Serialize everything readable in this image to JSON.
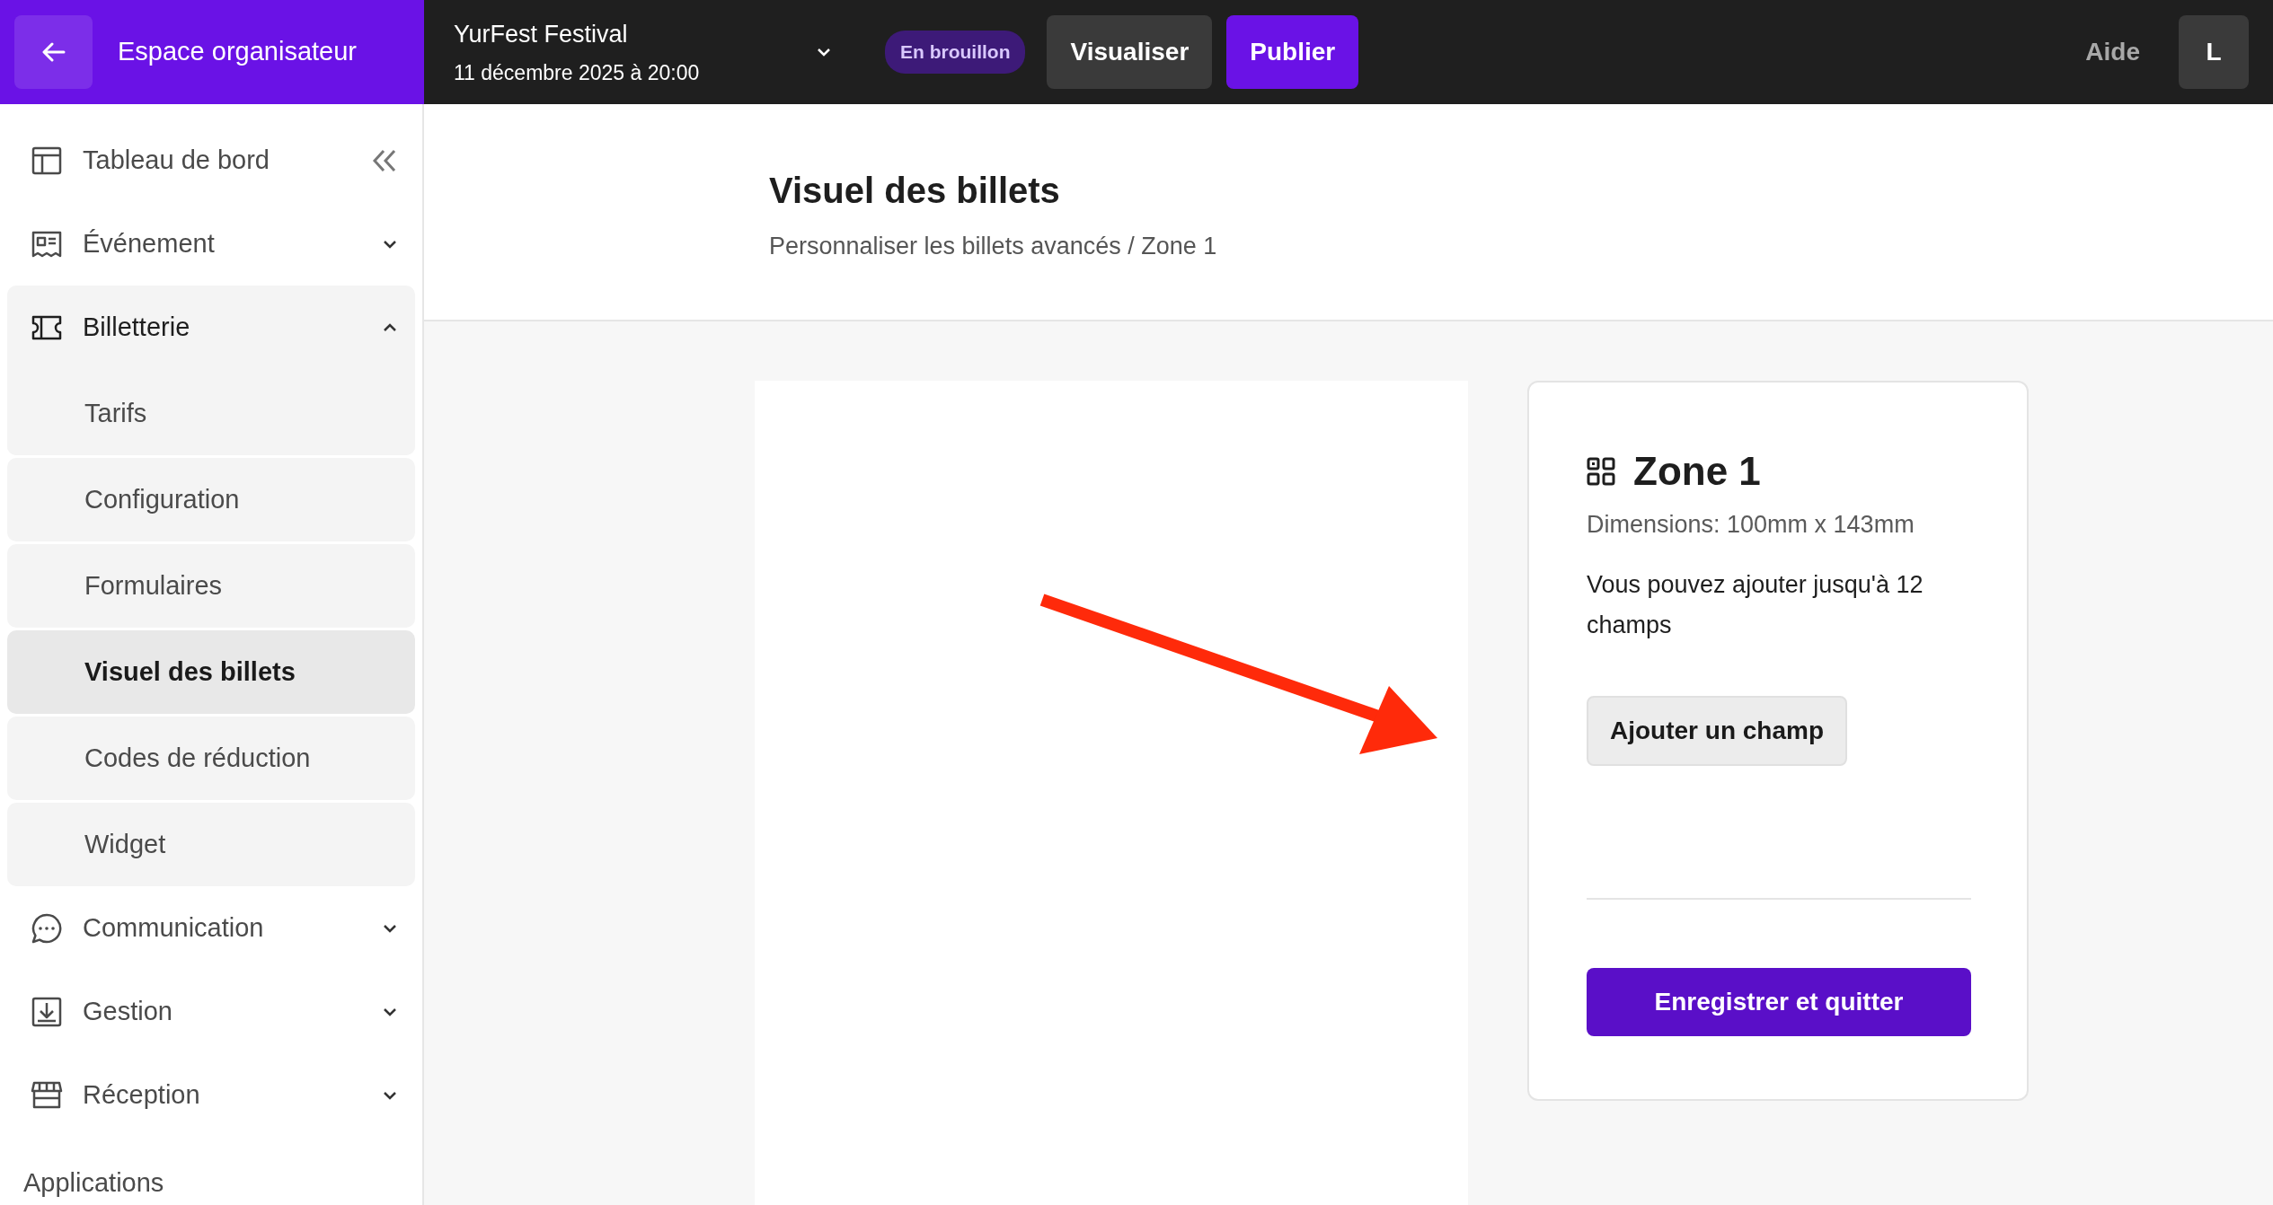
{
  "top_bar": {
    "brand": "Espace organisateur",
    "event": {
      "name": "YurFest Festival",
      "date": "11 décembre 2025 à 20:00"
    },
    "status_badge": "En brouillon",
    "buttons": [
      {
        "label": "Visualiser",
        "kind": "secondary"
      },
      {
        "label": "Publier",
        "kind": "primary"
      }
    ],
    "help": "Aide",
    "avatar": "L"
  },
  "sidebar": {
    "items": [
      {
        "label": "Tableau de bord"
      },
      {
        "label": "Événement",
        "expanded": false
      },
      {
        "label": "Billetterie",
        "expanded": true,
        "children": [
          {
            "label": "Tarifs",
            "selected": false
          },
          {
            "label": "Configuration",
            "selected": false
          },
          {
            "label": "Formulaires",
            "selected": false
          },
          {
            "label": "Visuel des billets",
            "selected": true
          },
          {
            "label": "Codes de réduction",
            "selected": false
          },
          {
            "label": "Widget",
            "selected": false
          }
        ]
      },
      {
        "label": "Communication",
        "expanded": false
      },
      {
        "label": "Gestion",
        "expanded": false
      },
      {
        "label": "Réception",
        "expanded": false
      }
    ],
    "section_heading": "Applications"
  },
  "page": {
    "title": "Visuel des billets",
    "breadcrumb": "Personnaliser les billets avancés / Zone 1"
  },
  "zone_card": {
    "title": "Zone 1",
    "dimensions": "Dimensions: 100mm x 143mm",
    "hint": "Vous pouvez ajouter jusqu'à 12 champs",
    "add_button": "Ajouter un champ",
    "save_button": "Enregistrer et quitter"
  }
}
